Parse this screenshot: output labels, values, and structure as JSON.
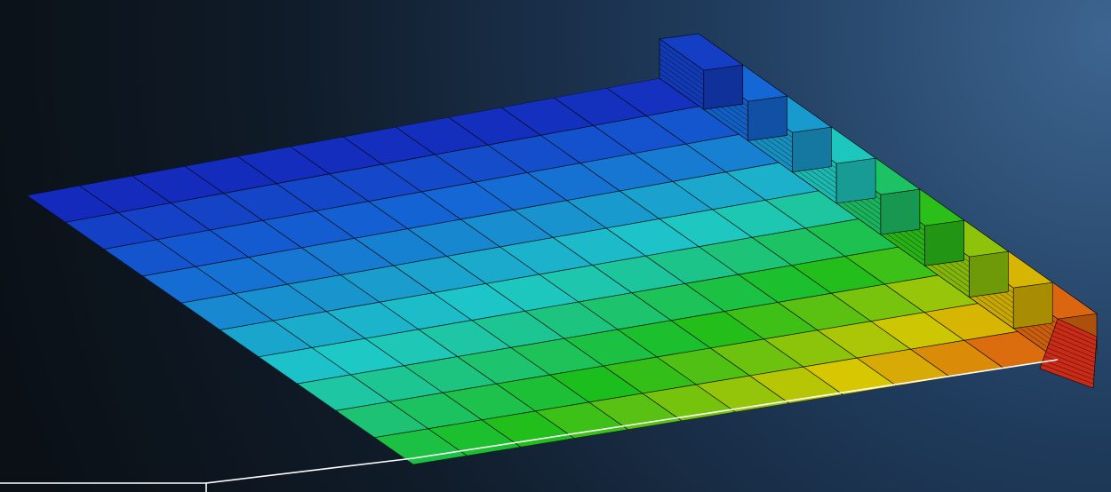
{
  "viewport": {
    "background": {
      "corner_dark": "#0a1016",
      "corner_light": "#3d6590"
    }
  },
  "model": {
    "plate_mesh": {
      "columns": 12,
      "rows": 10
    },
    "step_count": 9,
    "colormap": [
      "#1418b4",
      "#1464d4",
      "#1ec8c8",
      "#1cbe1c",
      "#d6c800",
      "#e03018"
    ],
    "mesh_line_color": "#000000"
  },
  "annotation": {
    "leader_line_color": "#ffffff"
  }
}
